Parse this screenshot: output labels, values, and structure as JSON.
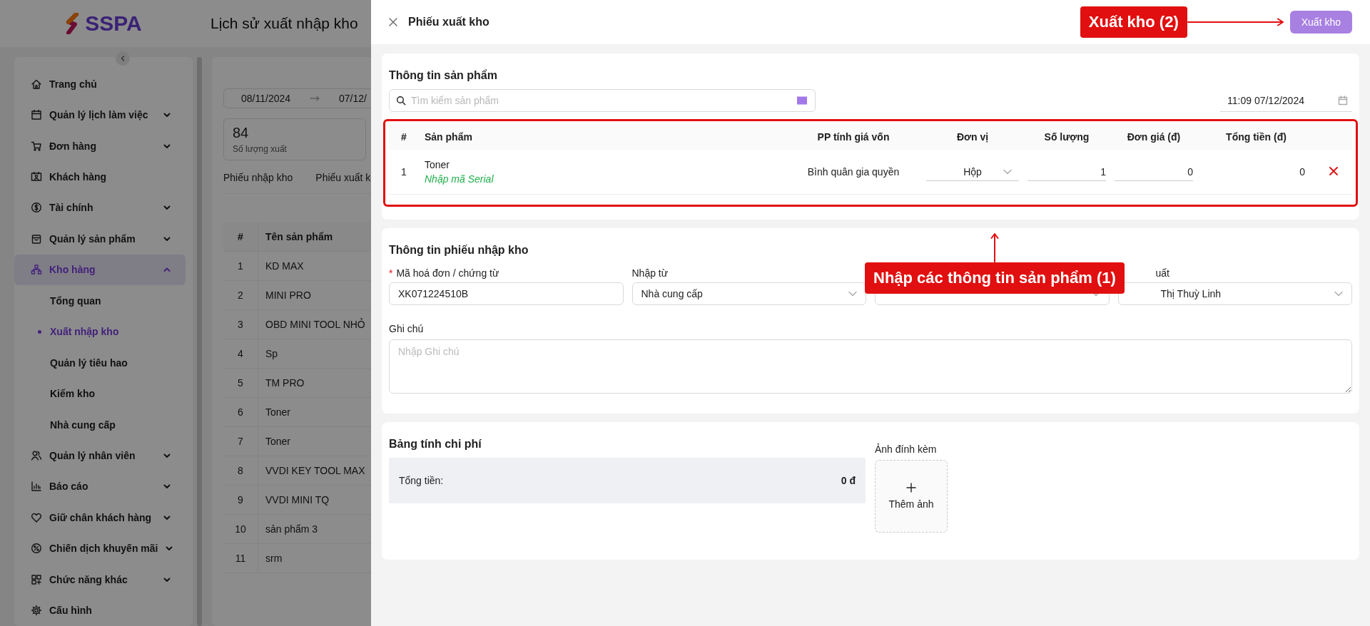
{
  "app": {
    "logo": "SSPA",
    "page_title": "Lịch sử xuất nhập kho"
  },
  "sidebar": {
    "items": [
      {
        "label": "Trang chủ",
        "selected": false
      },
      {
        "label": "Quản lý lịch làm việc",
        "expanded": false,
        "selected": false
      },
      {
        "label": "Đơn hàng",
        "expanded": false,
        "selected": false
      },
      {
        "label": "Khách hàng",
        "selected": false
      },
      {
        "label": "Tài chính",
        "expanded": false,
        "selected": false
      },
      {
        "label": "Quản lý sản phẩm",
        "expanded": false,
        "selected": false
      },
      {
        "label": "Kho hàng",
        "expanded": true,
        "selected": true,
        "children": [
          {
            "label": "Tổng quan",
            "selected": false
          },
          {
            "label": "Xuất nhập kho",
            "selected": true
          },
          {
            "label": "Quản lý tiêu hao",
            "selected": false
          },
          {
            "label": "Kiểm kho",
            "selected": false
          },
          {
            "label": "Nhà cung cấp",
            "selected": false
          }
        ]
      },
      {
        "label": "Quản lý nhân viên",
        "expanded": false,
        "selected": false
      },
      {
        "label": "Báo cáo",
        "expanded": false,
        "selected": false
      },
      {
        "label": "Giữ chân khách hàng",
        "expanded": false,
        "selected": false
      },
      {
        "label": "Chiến dịch khuyến mãi",
        "expanded": false,
        "selected": false
      },
      {
        "label": "Chức năng khác",
        "expanded": false,
        "selected": false
      },
      {
        "label": "Cấu hình",
        "selected": false
      }
    ]
  },
  "background": {
    "date_range": {
      "start": "08/11/2024",
      "end": "07/12/"
    },
    "stat": {
      "value": "84",
      "label": "Số lượng xuất"
    },
    "tabs": [
      {
        "label": "Phiếu nhập kho",
        "selected": false
      },
      {
        "label": "Phiếu xuất k",
        "selected": false
      }
    ],
    "table": {
      "columns": [
        "#",
        "Tên sản phẩm"
      ],
      "rows": [
        [
          "1",
          "KD MAX"
        ],
        [
          "2",
          "MINI PRO"
        ],
        [
          "3",
          "OBD MINI TOOL NHỎ"
        ],
        [
          "4",
          "Sp"
        ],
        [
          "5",
          "TM PRO"
        ],
        [
          "6",
          "Toner"
        ],
        [
          "7",
          "Toner"
        ],
        [
          "8",
          "VVDI KEY TOOL MAX"
        ],
        [
          "9",
          "VVDI MINI TQ"
        ],
        [
          "10",
          "sản phẩm 3"
        ],
        [
          "11",
          "srm"
        ]
      ]
    }
  },
  "drawer": {
    "title": "Phiếu xuất kho",
    "submit": {
      "label": "Xuất kho",
      "disabled": true
    },
    "product_section": {
      "title": "Thông tin sản phẩm",
      "search": {
        "placeholder": "Tìm kiếm sản phẩm"
      },
      "datetime": "11:09 07/12/2024",
      "table": {
        "columns": [
          "#",
          "Sản phẩm",
          "PP tính giá vốn",
          "Đơn vị",
          "Số lượng",
          "Đơn giá (đ)",
          "Tổng tiền (đ)"
        ],
        "rows": [
          {
            "index": "1",
            "product": "Toner",
            "serial_link": "Nhập mã Serial",
            "cost_method": "Bình quân gia quyền",
            "unit": "Hộp",
            "quantity": "1",
            "unit_price": "0",
            "total": "0"
          }
        ]
      }
    },
    "info_section": {
      "title": "Thông tin phiếu nhập kho",
      "fields": [
        {
          "kind": "text",
          "label": "Mã hoá đơn / chứng từ",
          "required_mark": "*",
          "value": "XK071224510B"
        },
        {
          "kind": "select",
          "label": "Nhập từ",
          "value": "Nhà cung cấp"
        },
        {
          "kind": "select"
        },
        {
          "kind": "select",
          "label": "uất",
          "value": "Thị Thuỳ Linh"
        }
      ],
      "note": {
        "label": "Ghi chú",
        "placeholder": "Nhập Ghi chú"
      }
    },
    "cost_section": {
      "title": "Bảng tính chi phí",
      "total_label": "Tổng tiền:",
      "total_value": "0 đ",
      "attachments_label": "Ảnh đính kèm",
      "add_photo": "Thêm ảnh"
    }
  },
  "annotations": [
    {
      "kind": "arrow-right",
      "text": "Xuất kho (2)"
    },
    {
      "kind": "arrow-up",
      "text": "Nhập các thông tin sản phẩm (1)"
    }
  ]
}
